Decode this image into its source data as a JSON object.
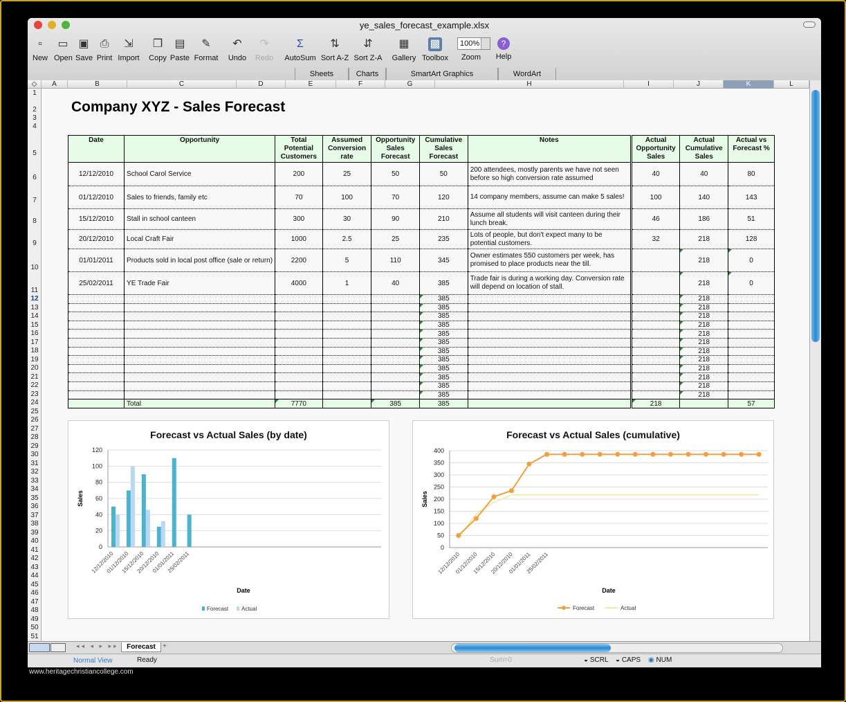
{
  "window": {
    "title": "ye_sales_forecast_example.xlsx"
  },
  "toolbar": [
    {
      "label": "New",
      "icon": "new-document-icon"
    },
    {
      "label": "Open",
      "icon": "open-folder-icon"
    },
    {
      "label": "Save",
      "icon": "save-disk-icon"
    },
    {
      "label": "Print",
      "icon": "printer-icon"
    },
    {
      "label": "Import",
      "icon": "import-icon"
    },
    {
      "label": "Copy",
      "icon": "copy-icon"
    },
    {
      "label": "Paste",
      "icon": "paste-icon"
    },
    {
      "label": "Format",
      "icon": "format-brush-icon"
    },
    {
      "label": "Undo",
      "icon": "undo-icon"
    },
    {
      "label": "Redo",
      "icon": "redo-icon"
    },
    {
      "label": "AutoSum",
      "icon": "sigma-icon"
    },
    {
      "label": "Sort A-Z",
      "icon": "sort-az-icon"
    },
    {
      "label": "Sort Z-A",
      "icon": "sort-za-icon"
    },
    {
      "label": "Gallery",
      "icon": "gallery-icon"
    },
    {
      "label": "Toolbox",
      "icon": "toolbox-icon"
    },
    {
      "label": "Zoom",
      "icon": "zoom-select",
      "value": "100%"
    },
    {
      "label": "Help",
      "icon": "help-icon"
    }
  ],
  "ribbon_tabs": [
    "Sheets",
    "Charts",
    "SmartArt Graphics",
    "WordArt"
  ],
  "columns": [
    "A",
    "B",
    "C",
    "D",
    "E",
    "F",
    "G",
    "H",
    "I",
    "J",
    "K",
    "L"
  ],
  "selected_column": "K",
  "rows": [
    "1",
    "2",
    "3",
    "4",
    "5",
    "6",
    "7",
    "8",
    "9",
    "10",
    "11",
    "12",
    "13",
    "14",
    "15",
    "16",
    "17",
    "18",
    "19",
    "20",
    "21",
    "22",
    "23",
    "24",
    "25",
    "26",
    "27",
    "28",
    "29",
    "30",
    "31",
    "32",
    "33",
    "34",
    "35",
    "36",
    "37",
    "38",
    "39",
    "40",
    "41",
    "42",
    "43",
    "44",
    "45",
    "46",
    "47",
    "48",
    "49",
    "50",
    "51"
  ],
  "selected_row": "12",
  "sheet": {
    "title": "Company XYZ - Sales Forecast",
    "headers": [
      "Date",
      "Opportunity",
      "Total Potential Customers",
      "Assumed Conversion rate",
      "Opportunity Sales Forecast",
      "Cumulative Sales Forecast",
      "Notes",
      "Actual Opportunity Sales",
      "Actual Cumulative Sales",
      "Actual vs Forecast %"
    ],
    "data_rows": [
      [
        "12/12/2010",
        "School Carol Service",
        "200",
        "25",
        "50",
        "50",
        "200 attendees, mostly parents we have not seen before so high conversion rate assumed",
        "40",
        "40",
        "80"
      ],
      [
        "01/12/2010",
        "Sales to friends, family etc",
        "70",
        "100",
        "70",
        "120",
        "14 company members, assume can make 5 sales!",
        "100",
        "140",
        "143"
      ],
      [
        "15/12/2010",
        "Stall in school canteen",
        "300",
        "30",
        "90",
        "210",
        "Assume all students will visit canteen during their lunch break.",
        "46",
        "186",
        "51"
      ],
      [
        "20/12/2010",
        "Local Craft Fair",
        "1000",
        "2.5",
        "25",
        "235",
        "Lots of people, but don't expect many to be potential customers.",
        "32",
        "218",
        "128"
      ],
      [
        "01/01/2011",
        "Products sold in local post office (sale or return)",
        "2200",
        "5",
        "110",
        "345",
        "Owner estimates 550 customers per week, has promised to place products near the till.",
        "",
        "218",
        "0"
      ],
      [
        "25/02/2011",
        "YE Trade Fair",
        "4000",
        "1",
        "40",
        "385",
        "Trade fair is during a working day. Conversion rate will depend on location of stall.",
        "",
        "218",
        "0"
      ]
    ],
    "empty_rows_cumulative": "385",
    "empty_rows_actual_cumulative": "218",
    "empty_row_count": 12,
    "total_row": {
      "label": "Total",
      "total_potential": "7770",
      "opportunity_forecast": "385",
      "cumulative_forecast": "385",
      "actual_opportunity": "218",
      "actual_vs_forecast": "57"
    }
  },
  "chart_data": [
    {
      "type": "bar",
      "title": "Forecast vs Actual Sales (by date)",
      "xlabel": "Date",
      "ylabel": "Sales",
      "ylim": [
        0,
        120
      ],
      "yticks": [
        "0",
        "20",
        "40",
        "60",
        "80",
        "100",
        "120"
      ],
      "categories": [
        "12/12/2010",
        "01/12/2010",
        "15/12/2010",
        "20/12/2010",
        "01/01/2011",
        "25/02/2011"
      ],
      "series": [
        {
          "name": "Forecast",
          "color": "#4bb3cf",
          "values": [
            50,
            70,
            90,
            25,
            110,
            40
          ]
        },
        {
          "name": "Actual",
          "color": "#b9d8f2",
          "values": [
            40,
            100,
            46,
            32,
            0,
            0
          ]
        }
      ],
      "legend": "bottom",
      "grid": true
    },
    {
      "type": "line",
      "title": "Forecast vs Actual Sales (cumulative)",
      "xlabel": "Date",
      "ylabel": "Sales",
      "ylim": [
        0,
        400
      ],
      "yticks": [
        "0",
        "50",
        "100",
        "150",
        "200",
        "250",
        "300",
        "350",
        "400"
      ],
      "categories": [
        "12/12/2010",
        "01/12/2010",
        "15/12/2010",
        "20/12/2010",
        "01/01/2011",
        "25/02/2011"
      ],
      "series": [
        {
          "name": "Forecast",
          "color": "#f0a040",
          "values": [
            50,
            120,
            210,
            235,
            345,
            385,
            385,
            385,
            385,
            385,
            385,
            385,
            385,
            385,
            385,
            385,
            385,
            385
          ]
        },
        {
          "name": "Actual",
          "color": "#f6e79a",
          "values": [
            40,
            140,
            186,
            218,
            218,
            218,
            218,
            218,
            218,
            218,
            218,
            218,
            218,
            218,
            218,
            218,
            218,
            218
          ]
        }
      ],
      "legend": "bottom",
      "grid": true
    }
  ],
  "sheet_tabs": [
    "Forecast"
  ],
  "status": {
    "view": "Normal View",
    "state": "Ready",
    "sum": "Sum=0",
    "scrl": "SCRL",
    "caps": "CAPS",
    "num": "NUM"
  },
  "watermark": "www.heritagechristiancollege.com"
}
